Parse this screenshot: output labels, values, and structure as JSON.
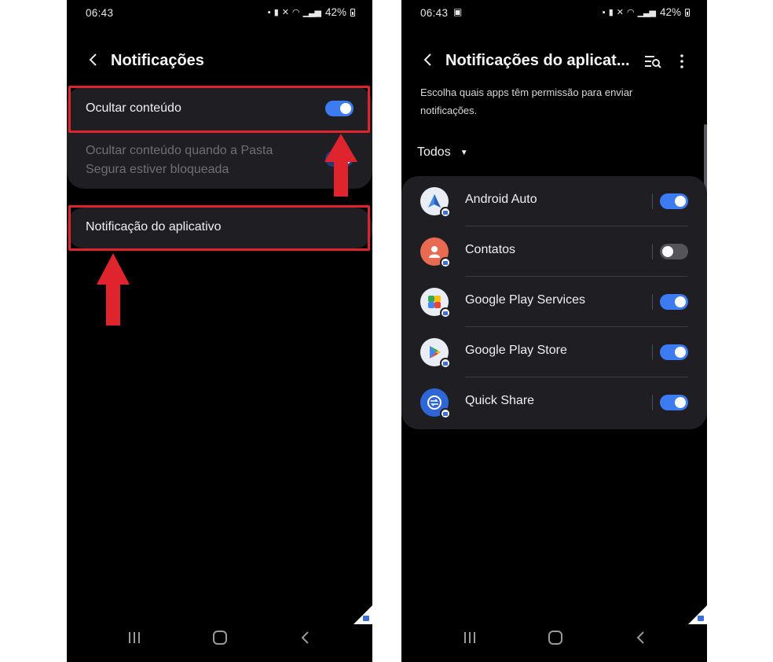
{
  "left": {
    "status": {
      "time": "06:43",
      "battery": "42%"
    },
    "title": "Notificações",
    "hide_content": {
      "label": "Ocultar conteúdo",
      "enabled": true
    },
    "secure_folder": {
      "label": "Ocultar conteúdo quando a Pasta Segura estiver bloqueada",
      "enabled": true,
      "disabled": true
    },
    "app_notifications": {
      "label": "Notificação do aplicativo"
    }
  },
  "right": {
    "status": {
      "time": "06:43",
      "battery": "42%"
    },
    "title": "Notificações do aplicat...",
    "description": "Escolha quais apps têm permissão para enviar notificações.",
    "filter": {
      "label": "Todos"
    },
    "apps": [
      {
        "name": "Android Auto",
        "enabled": true,
        "icon": "android-auto-icon",
        "color": "#e9eef6"
      },
      {
        "name": "Contatos",
        "enabled": false,
        "icon": "contacts-icon",
        "color": "#e86a52"
      },
      {
        "name": "Google Play Services",
        "enabled": true,
        "icon": "play-services-icon",
        "color": "#e9eef6"
      },
      {
        "name": "Google Play Store",
        "enabled": true,
        "icon": "play-store-icon",
        "color": "#e9eef6"
      },
      {
        "name": "Quick Share",
        "enabled": true,
        "icon": "quick-share-icon",
        "color": "#2f66d6"
      }
    ]
  },
  "colors": {
    "toggle_on": "#3d7bf2",
    "toggle_off": "#545459",
    "highlight": "#e0242d",
    "background": "#000000",
    "card": "#1f1f23"
  }
}
